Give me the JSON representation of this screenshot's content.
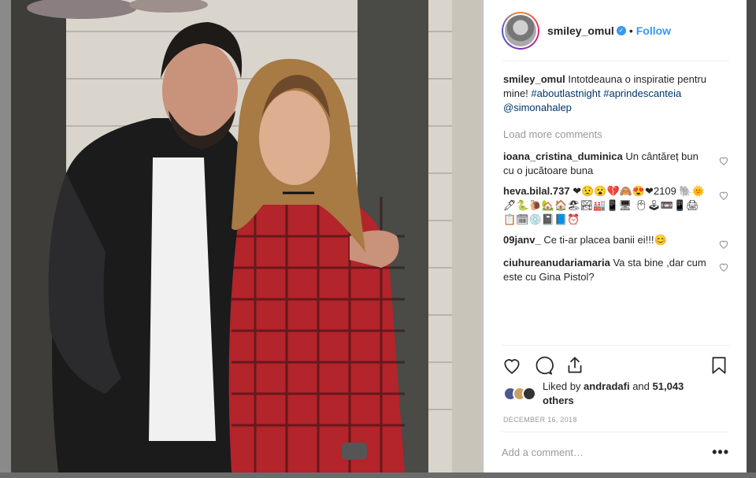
{
  "post": {
    "username": "smiley_omul",
    "dot": "•",
    "follow_label": "Follow",
    "caption_user": "smiley_omul",
    "caption_text": "Intotdeauna o inspiratie pentru mine!",
    "hashtag1": "#aboutlastnight",
    "hashtag2": "#aprindescanteia",
    "mention": "@simonahalep",
    "load_more": "Load more comments",
    "comments": [
      {
        "user": "ioana_cristina_duminica",
        "text": "Un cântăreț bun cu o jucătoare buna"
      },
      {
        "user": "heva.bilal.737",
        "text": "❤😟😮💔🙈😍❤2109 🐘🌞🖊🐍🐌🏡🏠🏖🏞🏭📱🖥 🖱🕹📼📱🖨📋🗓💿📓📘⏰"
      },
      {
        "user": "09janv_",
        "text": "Ce ti-ar placea banii ei!!!😊"
      },
      {
        "user": "ciuhureanudariamaria",
        "text": "Va sta bine ,dar cum este cu Gina Pistol?"
      }
    ],
    "liked_by_prefix": "Liked by",
    "liked_by_user": "andradafi",
    "liked_by_suffix": "and",
    "others": "51,043 others",
    "date": "DECEMBER 16, 2018",
    "add_comment_placeholder": "Add a comment…",
    "more_label": "•••"
  },
  "colors": {
    "accent": "#3897f0",
    "link": "#003569",
    "muted": "#999999",
    "text": "#262626"
  },
  "icons": [
    "verified-badge-icon",
    "heart-icon",
    "comment-icon",
    "share-icon",
    "bookmark-icon",
    "more-options-icon"
  ]
}
